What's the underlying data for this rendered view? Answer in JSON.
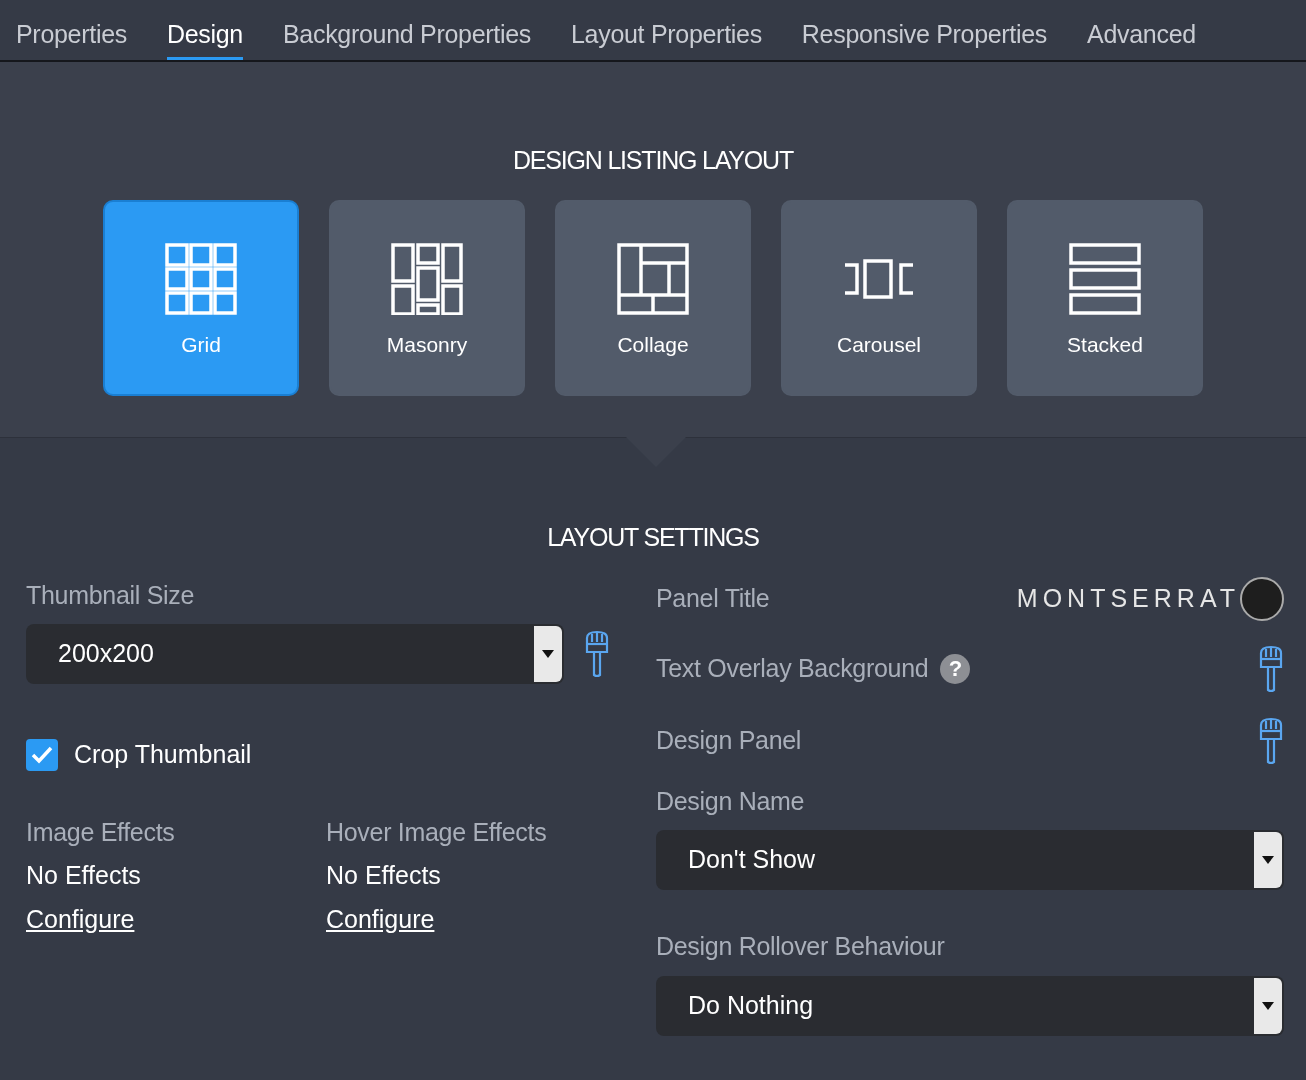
{
  "tabs": [
    {
      "label": "Properties",
      "selected": false
    },
    {
      "label": "Design",
      "selected": true
    },
    {
      "label": "Background Properties",
      "selected": false
    },
    {
      "label": "Layout Properties",
      "selected": false
    },
    {
      "label": "Responsive Properties",
      "selected": false
    },
    {
      "label": "Advanced",
      "selected": false
    }
  ],
  "listing_layout": {
    "title": "DESIGN LISTING LAYOUT",
    "options": [
      {
        "label": "Grid",
        "kind": "grid",
        "selected": true
      },
      {
        "label": "Masonry",
        "kind": "masonry",
        "selected": false
      },
      {
        "label": "Collage",
        "kind": "collage",
        "selected": false
      },
      {
        "label": "Carousel",
        "kind": "carousel",
        "selected": false
      },
      {
        "label": "Stacked",
        "kind": "stacked",
        "selected": false
      }
    ]
  },
  "layout_settings": {
    "title": "LAYOUT SETTINGS",
    "thumbnail_size": {
      "label": "Thumbnail Size",
      "value": "200x200"
    },
    "crop_thumbnail": {
      "label": "Crop Thumbnail",
      "checked": true
    },
    "effects": [
      {
        "label": "Image Effects",
        "value": "No Effects",
        "link": "Configure"
      },
      {
        "label": "Hover Image Effects",
        "value": "No Effects",
        "link": "Configure"
      }
    ],
    "panel_title": {
      "label": "Panel Title",
      "font": "MONTSERRAT"
    },
    "text_overlay_background": {
      "label": "Text Overlay Background",
      "help": "?"
    },
    "design_panel": {
      "label": "Design Panel"
    },
    "design_name": {
      "label": "Design Name",
      "value": "Don't Show"
    },
    "design_rollover_behaviour": {
      "label": "Design Rollover Behaviour",
      "value": "Do Nothing"
    }
  }
}
